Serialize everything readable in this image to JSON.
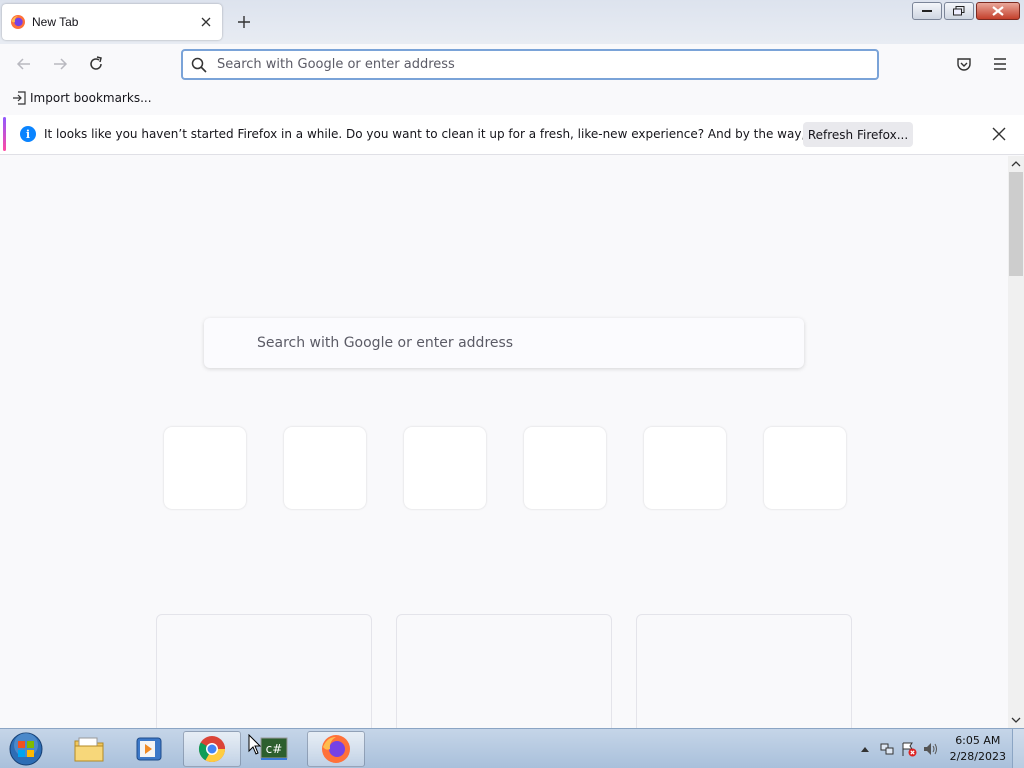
{
  "tab": {
    "title": "New Tab"
  },
  "urlbar": {
    "placeholder": "Search with Google or enter address"
  },
  "bookmarks": {
    "import_label": "Import bookmarks..."
  },
  "notification": {
    "message": "It looks like you haven’t started Firefox in a while. Do you want to clean it up for a fresh, like-new experience? And by the way, welcome back!",
    "button_label": "Refresh Firefox..."
  },
  "newtab": {
    "search_placeholder": "Search with Google or enter address",
    "top_sites_count": 6,
    "story_cards_count": 3
  },
  "taskbar": {
    "items": [
      "start-orb",
      "windows-explorer",
      "media-player",
      "google-chrome",
      "csharp-app",
      "firefox"
    ],
    "active": "firefox",
    "clock_time": "6:05 AM",
    "clock_date": "2/28/2023"
  },
  "colors": {
    "accent": "#0a84ff",
    "urlbar_focus": "#7aa3d8",
    "notification_gradient": [
      "#9059ff",
      "#ff4aa2"
    ]
  }
}
